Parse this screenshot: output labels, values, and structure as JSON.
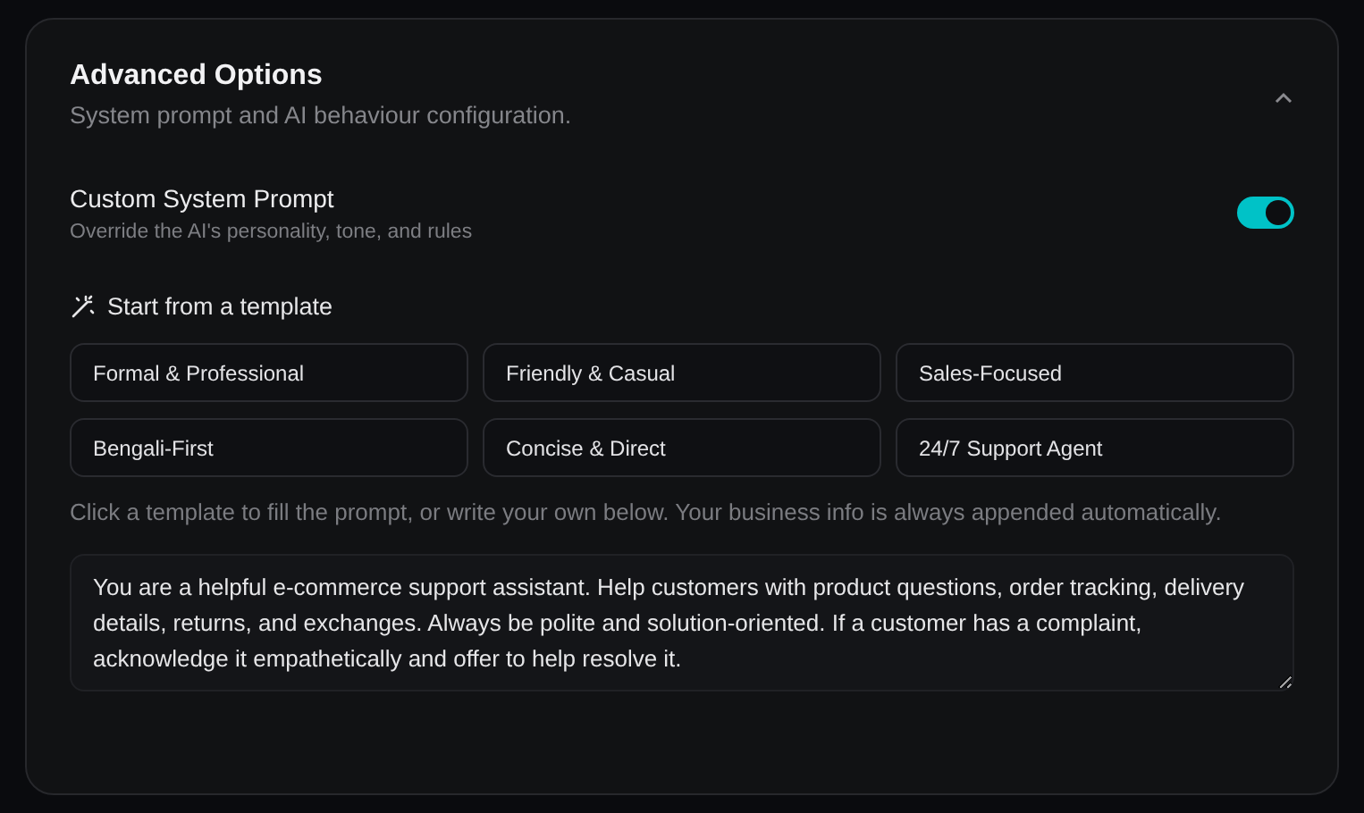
{
  "section": {
    "title": "Advanced Options",
    "subtitle": "System prompt and AI behaviour configuration.",
    "expanded": true
  },
  "custom_prompt": {
    "label": "Custom System Prompt",
    "description": "Override the AI's personality, tone, and rules",
    "on": true
  },
  "templates": {
    "heading": "Start from a template",
    "items": [
      {
        "label": "Formal & Professional"
      },
      {
        "label": "Friendly & Casual"
      },
      {
        "label": "Sales-Focused"
      },
      {
        "label": "Bengali-First"
      },
      {
        "label": "Concise & Direct"
      },
      {
        "label": "24/7 Support Agent"
      }
    ],
    "hint": "Click a template to fill the prompt, or write your own below. Your business info is always appended automatically."
  },
  "prompt": {
    "value": "You are a helpful e-commerce support assistant. Help customers with product questions, order tracking, delivery details, returns, and exchanges. Always be polite and solution-oriented. If a customer has a complaint, acknowledge it empathetically and offer to help resolve it."
  }
}
